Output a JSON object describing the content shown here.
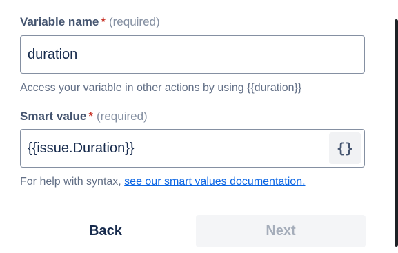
{
  "variable_name": {
    "label": "Variable name",
    "required_marker": "*",
    "required_text": "(required)",
    "value": "duration",
    "help": "Access your variable in other actions by using {{duration}}"
  },
  "smart_value": {
    "label": "Smart value",
    "required_marker": "*",
    "required_text": "(required)",
    "value": "{{issue.Duration}}",
    "insert_button_glyph": "{}",
    "help_prefix": "For help with syntax, ",
    "help_link": "see our smart values documentation."
  },
  "footer": {
    "back_label": "Back",
    "next_label": "Next"
  },
  "icons": {
    "smart_value_button": "curly-braces-icon"
  },
  "colors": {
    "required_star": "#c9372c",
    "link": "#0c66e4",
    "disabled_button_bg": "#f4f5f7"
  }
}
